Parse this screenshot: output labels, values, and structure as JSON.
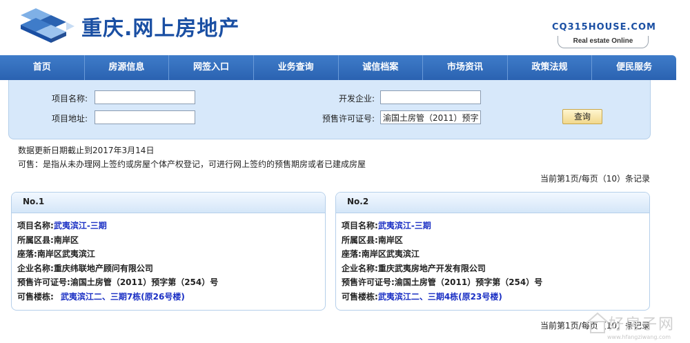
{
  "header": {
    "title": "重庆.网上房地产",
    "domain": "CQ315HOUSE.COM",
    "slogan": "Real estate Online",
    "brand_color": "#1a4fa3"
  },
  "nav": {
    "items": [
      "首页",
      "房源信息",
      "网签入口",
      "业务查询",
      "诚信档案",
      "市场资讯",
      "政策法规",
      "便民服务"
    ],
    "bg_color": "#2a62b1"
  },
  "search": {
    "project_name_label": "项目名称:",
    "project_name_value": "",
    "developer_label": "开发企业:",
    "developer_value": "",
    "project_address_label": "项目地址:",
    "project_address_value": "",
    "permit_label": "预售许可证号:",
    "permit_value": "渝国土房管（2011）预字",
    "query_button": "查询"
  },
  "info": {
    "update_date": "数据更新日期截止到2017年3月14日",
    "available_note": "可售：是指从未办理网上签约或房屋个体产权登记，可进行网上签约的预售期房或者已建成房屋",
    "page_info_top": "当前第1页/每页（10）条记录",
    "page_info_bottom": "当前第1页/每页（10）条记录"
  },
  "results": [
    {
      "no": "No.1",
      "project_name_label": "项目名称:",
      "project_name": "武夷滨江-三期",
      "district_label": "所属区县:",
      "district": "南岸区",
      "location_label": "座落:",
      "location": "南岸区武夷滨江",
      "company_label": "企业名称:",
      "company": "重庆纬联地产顾问有限公司",
      "permit_label": "预售许可证号:",
      "permit": "渝国土房管（2011）预字第（254）号",
      "building_label": "可售楼栋:",
      "building": "武夷滨江二、三期7栋(原26号楼)"
    },
    {
      "no": "No.2",
      "project_name_label": "项目名称:",
      "project_name": "武夷滨江-三期",
      "district_label": "所属区县:",
      "district": "南岸区",
      "location_label": "座落:",
      "location": "南岸区武夷滨江",
      "company_label": "企业名称:",
      "company": "重庆武夷房地产开发有限公司",
      "permit_label": "预售许可证号:",
      "permit": "渝国土房管（2011）预字第（254）号",
      "building_label": "可售楼栋:",
      "building": "武夷滨江二、三期4栋(原23号楼)"
    }
  ],
  "watermark": {
    "text": "好房子网",
    "url": "www.hfangziwang.com"
  }
}
